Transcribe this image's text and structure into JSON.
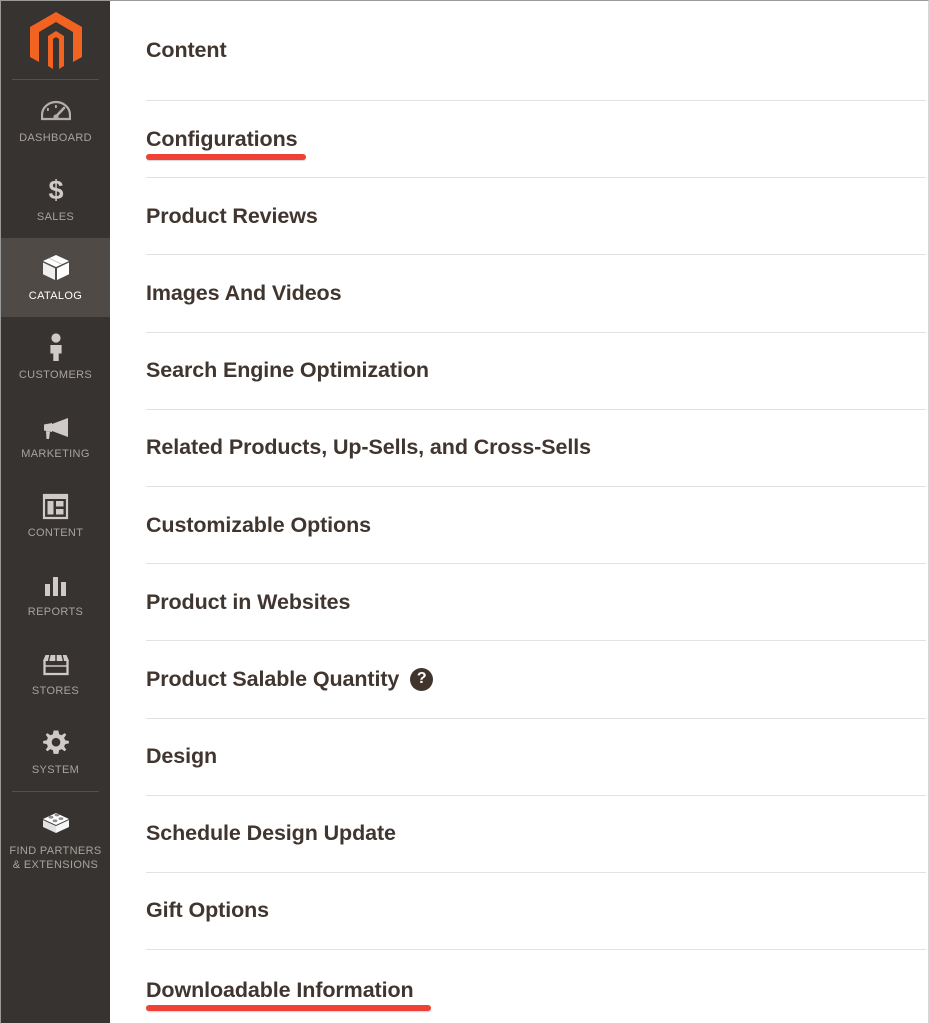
{
  "sidebar": {
    "logo": {
      "icon": "magento-logo-icon",
      "color": "#f26322"
    },
    "items": [
      {
        "label": "DASHBOARD",
        "icon": "dashboard-gauge-icon",
        "active": false
      },
      {
        "label": "SALES",
        "icon": "dollar-sign-icon",
        "active": false
      },
      {
        "label": "CATALOG",
        "icon": "box-catalog-icon",
        "active": true
      },
      {
        "label": "CUSTOMERS",
        "icon": "person-icon",
        "active": false
      },
      {
        "label": "MARKETING",
        "icon": "megaphone-icon",
        "active": false
      },
      {
        "label": "CONTENT",
        "icon": "layout-page-icon",
        "active": false
      },
      {
        "label": "REPORTS",
        "icon": "bar-chart-icon",
        "active": false
      },
      {
        "label": "STORES",
        "icon": "storefront-icon",
        "active": false
      },
      {
        "label": "SYSTEM",
        "icon": "gear-icon",
        "active": false
      },
      {
        "label": "FIND PARTNERS\n& EXTENSIONS",
        "label_line1": "FIND PARTNERS",
        "label_line2": "& EXTENSIONS",
        "icon": "extension-brick-icon",
        "active": false
      }
    ]
  },
  "main": {
    "sections": [
      {
        "title": "Content",
        "annotated": false,
        "help": false
      },
      {
        "title": "Configurations",
        "annotated": true,
        "help": false
      },
      {
        "title": "Product Reviews",
        "annotated": false,
        "help": false
      },
      {
        "title": "Images And Videos",
        "annotated": false,
        "help": false
      },
      {
        "title": "Search Engine Optimization",
        "annotated": false,
        "help": false
      },
      {
        "title": "Related Products, Up-Sells, and Cross-Sells",
        "annotated": false,
        "help": false
      },
      {
        "title": "Customizable Options",
        "annotated": false,
        "help": false
      },
      {
        "title": "Product in Websites",
        "annotated": false,
        "help": false
      },
      {
        "title": "Product Salable Quantity",
        "annotated": false,
        "help": true,
        "help_glyph": "?"
      },
      {
        "title": "Design",
        "annotated": false,
        "help": false
      },
      {
        "title": "Schedule Design Update",
        "annotated": false,
        "help": false
      },
      {
        "title": "Gift Options",
        "annotated": false,
        "help": false
      },
      {
        "title": "Downloadable Information",
        "annotated": true,
        "help": false
      }
    ]
  },
  "annotation": {
    "color": "#ef4136",
    "style": "red-underline"
  }
}
